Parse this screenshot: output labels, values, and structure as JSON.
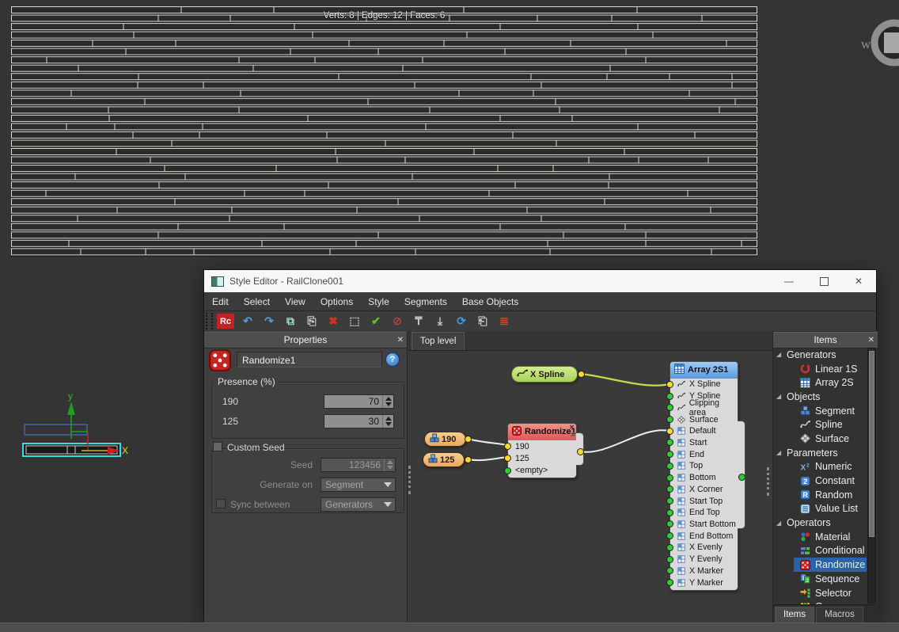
{
  "viewport": {
    "stats": "Verts: 8 | Edges: 12 | Faces: 6",
    "axis_y_label": "y",
    "axis_x_label": "X",
    "watermark_letter": "w"
  },
  "window": {
    "title": "Style Editor - RailClone001",
    "controls": {
      "minimize": "—",
      "close": "✕"
    }
  },
  "menu": {
    "items": [
      "Edit",
      "Select",
      "View",
      "Options",
      "Style",
      "Segments",
      "Base Objects"
    ]
  },
  "toolbar": {
    "icons": [
      {
        "name": "railclone-logo",
        "glyph": "Rc",
        "color": "#ffffff",
        "boxed": true
      },
      {
        "name": "undo",
        "glyph": "↶",
        "color": "#4d9fe0"
      },
      {
        "name": "redo",
        "glyph": "↷",
        "color": "#4d9fe0"
      },
      {
        "name": "copy",
        "glyph": "⧉",
        "color": "#9fd8cc"
      },
      {
        "name": "paste",
        "glyph": "⎘",
        "color": "#cfd4cc"
      },
      {
        "name": "delete",
        "glyph": "✖",
        "color": "#d83018"
      },
      {
        "name": "ghost-segment",
        "glyph": "⬚",
        "color": "#b8bcc0"
      },
      {
        "name": "build-check",
        "glyph": "✔",
        "color": "#58c230"
      },
      {
        "name": "auto-build-off",
        "glyph": "⊘",
        "color": "#a84444"
      },
      {
        "name": "collapse-top",
        "glyph": "₸",
        "color": "#c8c8c8"
      },
      {
        "name": "update-box",
        "glyph": "⤓",
        "color": "#c8c8c8"
      },
      {
        "name": "refresh",
        "glyph": "⟳",
        "color": "#3d9ce8"
      },
      {
        "name": "export",
        "glyph": "⎗",
        "color": "#c8c8c8"
      },
      {
        "name": "notes",
        "glyph": "≣",
        "color": "#d84830"
      }
    ]
  },
  "properties": {
    "header": "Properties",
    "close_glyph": "✕",
    "name_value": "Randomize1",
    "help_glyph": "?",
    "presence": {
      "title": "Presence (%)",
      "rows": [
        {
          "label": "190",
          "value": "70"
        },
        {
          "label": "125",
          "value": "30"
        }
      ]
    },
    "custom_seed": {
      "title": "Custom Seed",
      "seed_label": "Seed",
      "seed_value": "123456",
      "generate_on_label": "Generate on",
      "generate_on_value": "Segment",
      "sync_label": "Sync between",
      "sync_value": "Generators"
    }
  },
  "graph": {
    "tab": "Top level",
    "xspline": {
      "label": "X Spline"
    },
    "value_nodes": [
      {
        "label": "190"
      },
      {
        "label": "125"
      }
    ],
    "randomize": {
      "title": "Randomize1",
      "close_glyph": "✕",
      "rows": [
        {
          "label": "190",
          "port": "yellow"
        },
        {
          "label": "125",
          "port": "yellow"
        },
        {
          "label": "<empty>",
          "port": "green"
        }
      ]
    },
    "array": {
      "title": "Array 2S1",
      "rows": [
        {
          "label": "X Spline",
          "port": "yellow",
          "icon": "spline"
        },
        {
          "label": "Y Spline",
          "port": "green",
          "icon": "spline"
        },
        {
          "label": "Clipping area",
          "port": "green",
          "icon": "spline"
        },
        {
          "label": "Surface",
          "port": "green",
          "icon": "surface"
        },
        {
          "label": "Default",
          "port": "yellow",
          "icon": "cell"
        },
        {
          "label": "Start",
          "port": "green",
          "icon": "cell"
        },
        {
          "label": "End",
          "port": "green",
          "icon": "cell"
        },
        {
          "label": "Top",
          "port": "green",
          "icon": "cell"
        },
        {
          "label": "Bottom",
          "port": "green",
          "icon": "cell"
        },
        {
          "label": "X Corner",
          "port": "green",
          "icon": "cell"
        },
        {
          "label": "Start Top",
          "port": "green",
          "icon": "cell"
        },
        {
          "label": "End Top",
          "port": "green",
          "icon": "cell"
        },
        {
          "label": "Start Bottom",
          "port": "green",
          "icon": "cell"
        },
        {
          "label": "End Bottom",
          "port": "green",
          "icon": "cell"
        },
        {
          "label": "X Evenly",
          "port": "green",
          "icon": "cell"
        },
        {
          "label": "Y Evenly",
          "port": "green",
          "icon": "cell"
        },
        {
          "label": "X Marker",
          "port": "green",
          "icon": "cell"
        },
        {
          "label": "Y Marker",
          "port": "green",
          "icon": "cell"
        }
      ]
    }
  },
  "items_panel": {
    "header": "Items",
    "close_glyph": "✕",
    "tree": [
      {
        "type": "group",
        "label": "Generators"
      },
      {
        "type": "item",
        "label": "Linear 1S",
        "icon": "linear"
      },
      {
        "type": "item",
        "label": "Array 2S",
        "icon": "grid"
      },
      {
        "type": "group",
        "label": "Objects"
      },
      {
        "type": "item",
        "label": "Segment",
        "icon": "cubes"
      },
      {
        "type": "item",
        "label": "Spline",
        "icon": "spline-light"
      },
      {
        "type": "item",
        "label": "Surface",
        "icon": "surface-light"
      },
      {
        "type": "group",
        "label": "Parameters"
      },
      {
        "type": "item",
        "label": "Numeric",
        "icon": "numeric"
      },
      {
        "type": "item",
        "label": "Constant",
        "icon": "constant"
      },
      {
        "type": "item",
        "label": "Random",
        "icon": "random"
      },
      {
        "type": "item",
        "label": "Value List",
        "icon": "valuelist"
      },
      {
        "type": "group",
        "label": "Operators"
      },
      {
        "type": "item",
        "label": "Material",
        "icon": "material"
      },
      {
        "type": "item",
        "label": "Conditional",
        "icon": "conditional"
      },
      {
        "type": "item",
        "label": "Randomize",
        "icon": "dice",
        "selected": true
      },
      {
        "type": "item",
        "label": "Sequence",
        "icon": "sequence"
      },
      {
        "type": "item",
        "label": "Selector",
        "icon": "selector"
      },
      {
        "type": "item",
        "label": "Compose",
        "icon": "compose"
      }
    ],
    "tabs": [
      {
        "label": "Items",
        "active": true
      },
      {
        "label": "Macros",
        "active": false
      }
    ]
  },
  "colors": {
    "selection": "#2a63aa",
    "port_yellow": "#ffd92a",
    "port_green": "#2ecc2e",
    "wire_spline": "#c6d84e",
    "wire_white": "#ededed",
    "node_green": "#b5da68",
    "node_orange": "#eeb270",
    "node_red_header": "#e66660",
    "node_blue_header": "#79aee9",
    "wireframe_line": "#d8ddd4"
  }
}
